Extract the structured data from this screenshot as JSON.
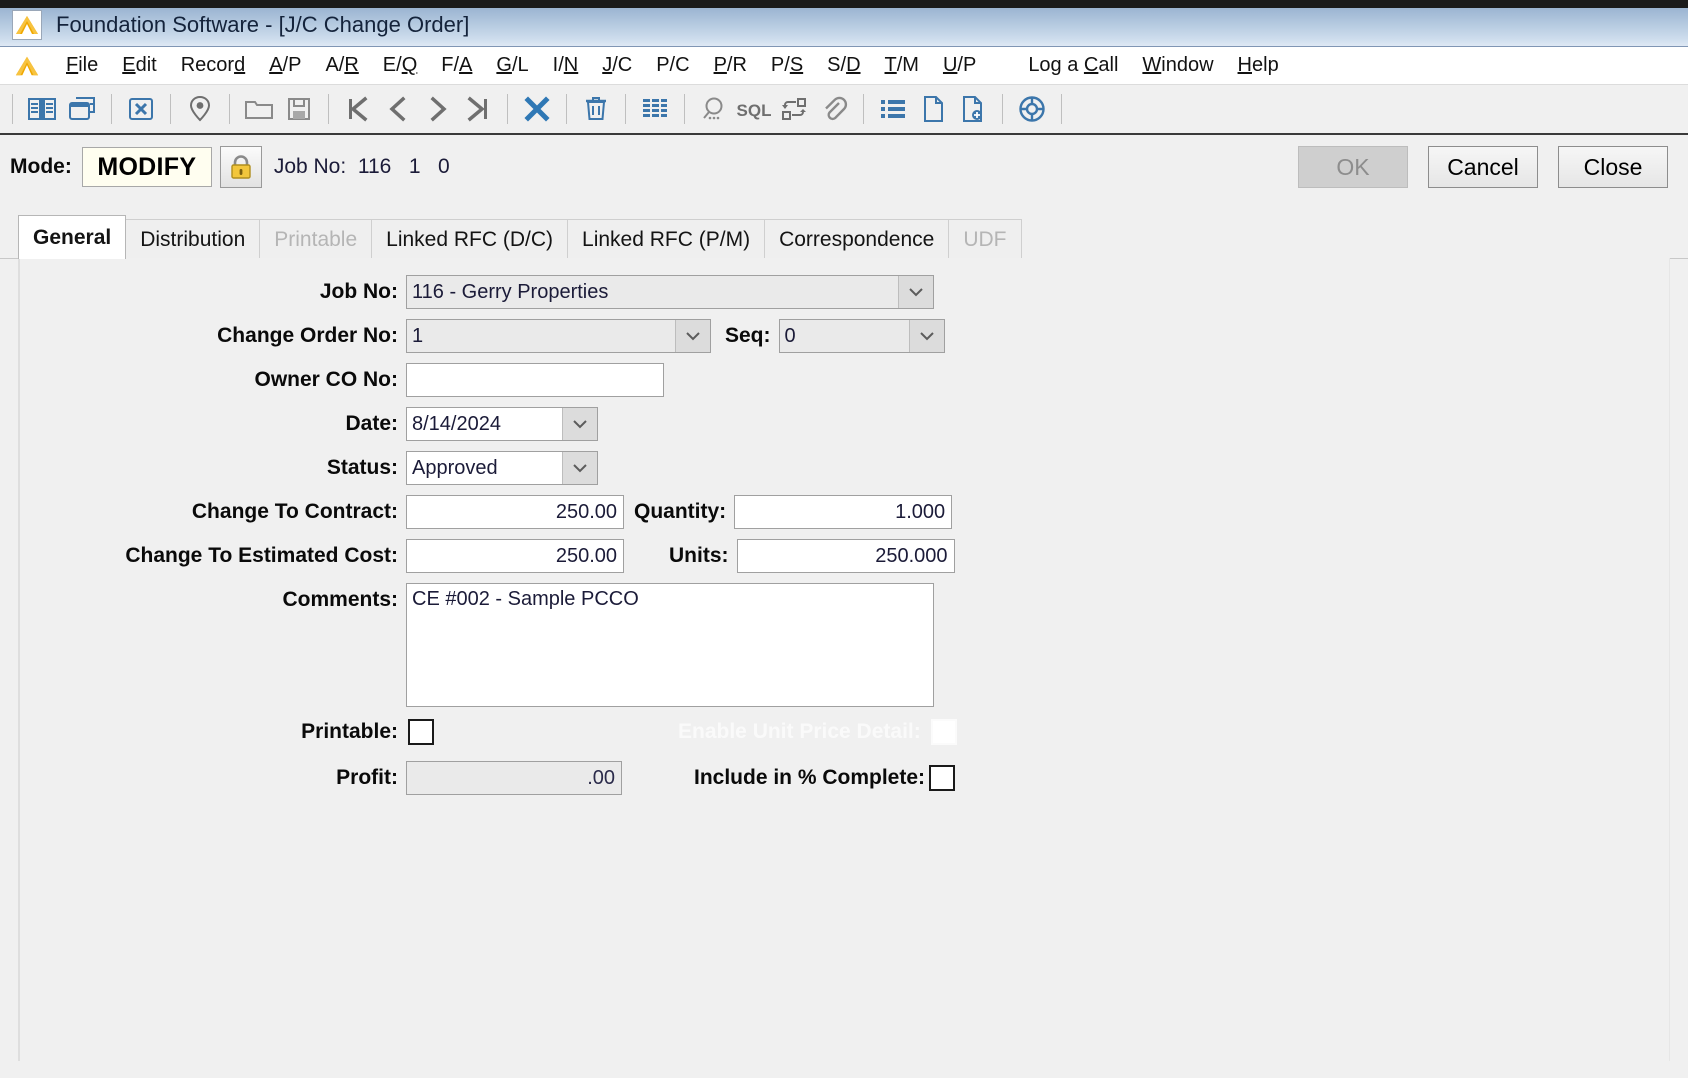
{
  "window": {
    "title": "Foundation Software - [J/C Change Order]",
    "logo_icon": "foundation-logo-icon"
  },
  "menubar": {
    "items": [
      {
        "label": "File",
        "accel": "F"
      },
      {
        "label": "Edit",
        "accel": "E"
      },
      {
        "label": "Record",
        "accel": "d"
      },
      {
        "label": "A/P",
        "accel": "A"
      },
      {
        "label": "A/R",
        "accel": "R"
      },
      {
        "label": "E/Q",
        "accel": "Q"
      },
      {
        "label": "F/A",
        "accel": "A"
      },
      {
        "label": "G/L",
        "accel": "G"
      },
      {
        "label": "I/N",
        "accel": "N"
      },
      {
        "label": "J/C",
        "accel": "J"
      },
      {
        "label": "P/C",
        "accel": ""
      },
      {
        "label": "P/R",
        "accel": "P"
      },
      {
        "label": "P/S",
        "accel": "S"
      },
      {
        "label": "S/D",
        "accel": "D"
      },
      {
        "label": "T/M",
        "accel": "T"
      },
      {
        "label": "U/P",
        "accel": "U"
      },
      {
        "label": "Log a Call",
        "accel": "C"
      },
      {
        "label": "Window",
        "accel": "W"
      },
      {
        "label": "Help",
        "accel": "H"
      }
    ]
  },
  "toolbar": {
    "buttons": [
      {
        "icon": "book-open-icon",
        "tooltip": "Open Book"
      },
      {
        "icon": "cascade-windows-icon",
        "tooltip": "Windows"
      },
      {
        "icon": "close-box-icon",
        "tooltip": "Close"
      },
      {
        "icon": "map-pin-icon",
        "tooltip": "Locate"
      },
      {
        "icon": "folder-icon",
        "tooltip": "Open"
      },
      {
        "icon": "floppy-save-icon",
        "tooltip": "Save"
      },
      {
        "icon": "first-record-icon",
        "tooltip": "First"
      },
      {
        "icon": "previous-record-icon",
        "tooltip": "Previous"
      },
      {
        "icon": "next-record-icon",
        "tooltip": "Next"
      },
      {
        "icon": "last-record-icon",
        "tooltip": "Last"
      },
      {
        "icon": "cancel-x-icon",
        "tooltip": "Cancel"
      },
      {
        "icon": "trash-delete-icon",
        "tooltip": "Delete"
      },
      {
        "icon": "grid-view-icon",
        "tooltip": "Grid"
      },
      {
        "icon": "magnifier-search-icon",
        "tooltip": "Search"
      },
      {
        "icon": "sql-query-icon",
        "tooltip": "SQL"
      },
      {
        "icon": "workflow-icon",
        "tooltip": "Workflow"
      },
      {
        "icon": "paperclip-attachment-icon",
        "tooltip": "Attachments"
      },
      {
        "icon": "list-view-icon",
        "tooltip": "List"
      },
      {
        "icon": "document-icon",
        "tooltip": "Document"
      },
      {
        "icon": "document-add-icon",
        "tooltip": "New Document"
      },
      {
        "icon": "lifering-help-icon",
        "tooltip": "Help"
      }
    ]
  },
  "modebar": {
    "mode_label": "Mode:",
    "mode_value": "MODIFY",
    "lock_icon": "lock-icon",
    "job_no_text": "Job No:  116   1   0",
    "ok_label": "OK",
    "ok_disabled": true,
    "cancel_label": "Cancel",
    "close_label": "Close"
  },
  "tabs": [
    {
      "label": "General",
      "active": true,
      "disabled": false
    },
    {
      "label": "Distribution",
      "active": false,
      "disabled": false
    },
    {
      "label": "Printable",
      "active": false,
      "disabled": true
    },
    {
      "label": "Linked RFC (D/C)",
      "active": false,
      "disabled": false
    },
    {
      "label": "Linked RFC (P/M)",
      "active": false,
      "disabled": false
    },
    {
      "label": "Correspondence",
      "active": false,
      "disabled": false
    },
    {
      "label": "UDF",
      "active": false,
      "disabled": true
    }
  ],
  "form": {
    "job_no": {
      "label": "Job No:",
      "value": "116 - Gerry Properties"
    },
    "change_order_no": {
      "label": "Change Order No:",
      "value": "1"
    },
    "seq": {
      "label": "Seq:",
      "value": "0"
    },
    "owner_co_no": {
      "label": "Owner CO No:",
      "value": ""
    },
    "date": {
      "label": "Date:",
      "value": "8/14/2024"
    },
    "status": {
      "label": "Status:",
      "value": "Approved"
    },
    "change_to_contract": {
      "label": "Change To Contract:",
      "value": "250.00"
    },
    "quantity": {
      "label": "Quantity:",
      "value": "1.000"
    },
    "change_to_estimated_cost": {
      "label": "Change To Estimated Cost:",
      "value": "250.00"
    },
    "units": {
      "label": "Units:",
      "value": "250.000"
    },
    "comments": {
      "label": "Comments:",
      "value": "CE #002 - Sample PCCO"
    },
    "printable": {
      "label": "Printable:",
      "checked": false
    },
    "enable_unit_price_detail": {
      "label": "Enable Unit Price Detail:",
      "checked": false,
      "disabled": true
    },
    "profit": {
      "label": "Profit:",
      "value": ".00"
    },
    "include_in_pct_complete": {
      "label": "Include in % Complete:",
      "checked": false
    }
  },
  "colors": {
    "titlebar_blue": "#a3bbd6",
    "toolbar_icon_blue": "#3c76ab",
    "toolbar_icon_gray": "#7d7d7d",
    "mode_field_bg": "#fffef0",
    "panel_bg": "#f0f0f0",
    "field_text": "#1b1b38"
  }
}
